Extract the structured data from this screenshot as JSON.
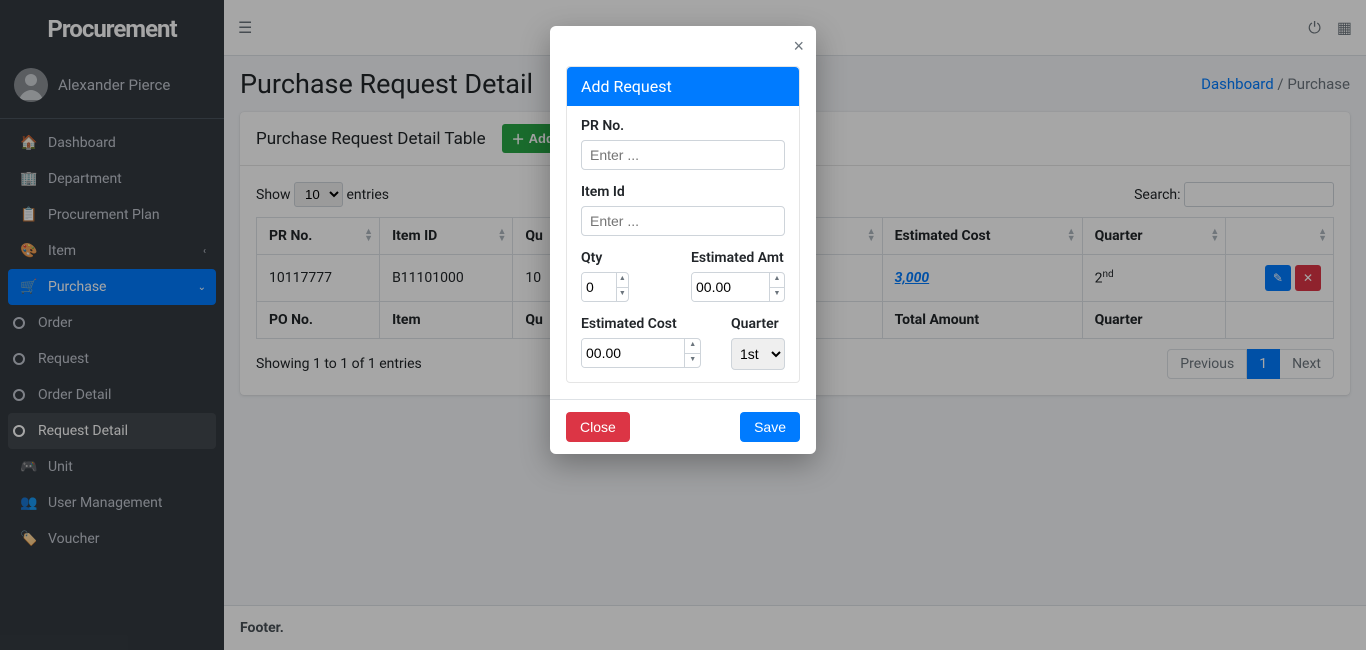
{
  "brand": "Procurement",
  "user": {
    "name": "Alexander Pierce"
  },
  "sidebar": {
    "items": [
      {
        "label": "Dashboard",
        "icon": "dashboard"
      },
      {
        "label": "Department",
        "icon": "building"
      },
      {
        "label": "Procurement Plan",
        "icon": "clipboard"
      },
      {
        "label": "Item",
        "icon": "palette",
        "chev": "left"
      },
      {
        "label": "Purchase",
        "icon": "cart",
        "chev": "down",
        "active": true
      },
      {
        "label": "Order",
        "icon": "circle",
        "sub": true
      },
      {
        "label": "Request",
        "icon": "circle",
        "sub": true
      },
      {
        "label": "Order Detail",
        "icon": "circle",
        "sub": true
      },
      {
        "label": "Request Detail",
        "icon": "circle",
        "sub": true,
        "subActive": true
      },
      {
        "label": "Unit",
        "icon": "gamepad"
      },
      {
        "label": "User Management",
        "icon": "users"
      },
      {
        "label": "Voucher",
        "icon": "tag"
      }
    ]
  },
  "page": {
    "title": "Purchase Request Detail",
    "breadcrumb": {
      "link": "Dashboard",
      "current": "Purchase"
    },
    "card_title": "Purchase Request Detail Table",
    "add_btn": "Add"
  },
  "datatable": {
    "show_label_pre": "Show",
    "show_label_post": "entries",
    "length": "10",
    "search_label": "Search:",
    "columns": [
      "PR No.",
      "Item ID",
      "Qu",
      "Estimated Cost",
      "Quarter",
      ""
    ],
    "row": {
      "pr_no": "10117777",
      "item_id": "B11101000",
      "qu": "10",
      "est_cost": "3,000",
      "quarter_num": "2",
      "quarter_suffix": "nd"
    },
    "footer_row": [
      "PO No.",
      "Item",
      "Qu",
      "Total Amount",
      "Quarter",
      ""
    ],
    "info": "Showing 1 to 1 of 1 entries",
    "pager": {
      "prev": "Previous",
      "page": "1",
      "next": "Next"
    }
  },
  "footer": "Footer.",
  "modal": {
    "title": "Add Request",
    "labels": {
      "pr_no": "PR No.",
      "item_id": "Item Id",
      "qty": "Qty",
      "est_amt": "Estimated Amt",
      "est_cost": "Estimated Cost",
      "quarter": "Quarter"
    },
    "placeholders": {
      "enter": "Enter ..."
    },
    "values": {
      "qty": "0",
      "est_amt": "00.00",
      "est_cost": "00.00",
      "quarter": "1st"
    },
    "buttons": {
      "close": "Close",
      "save": "Save"
    }
  }
}
